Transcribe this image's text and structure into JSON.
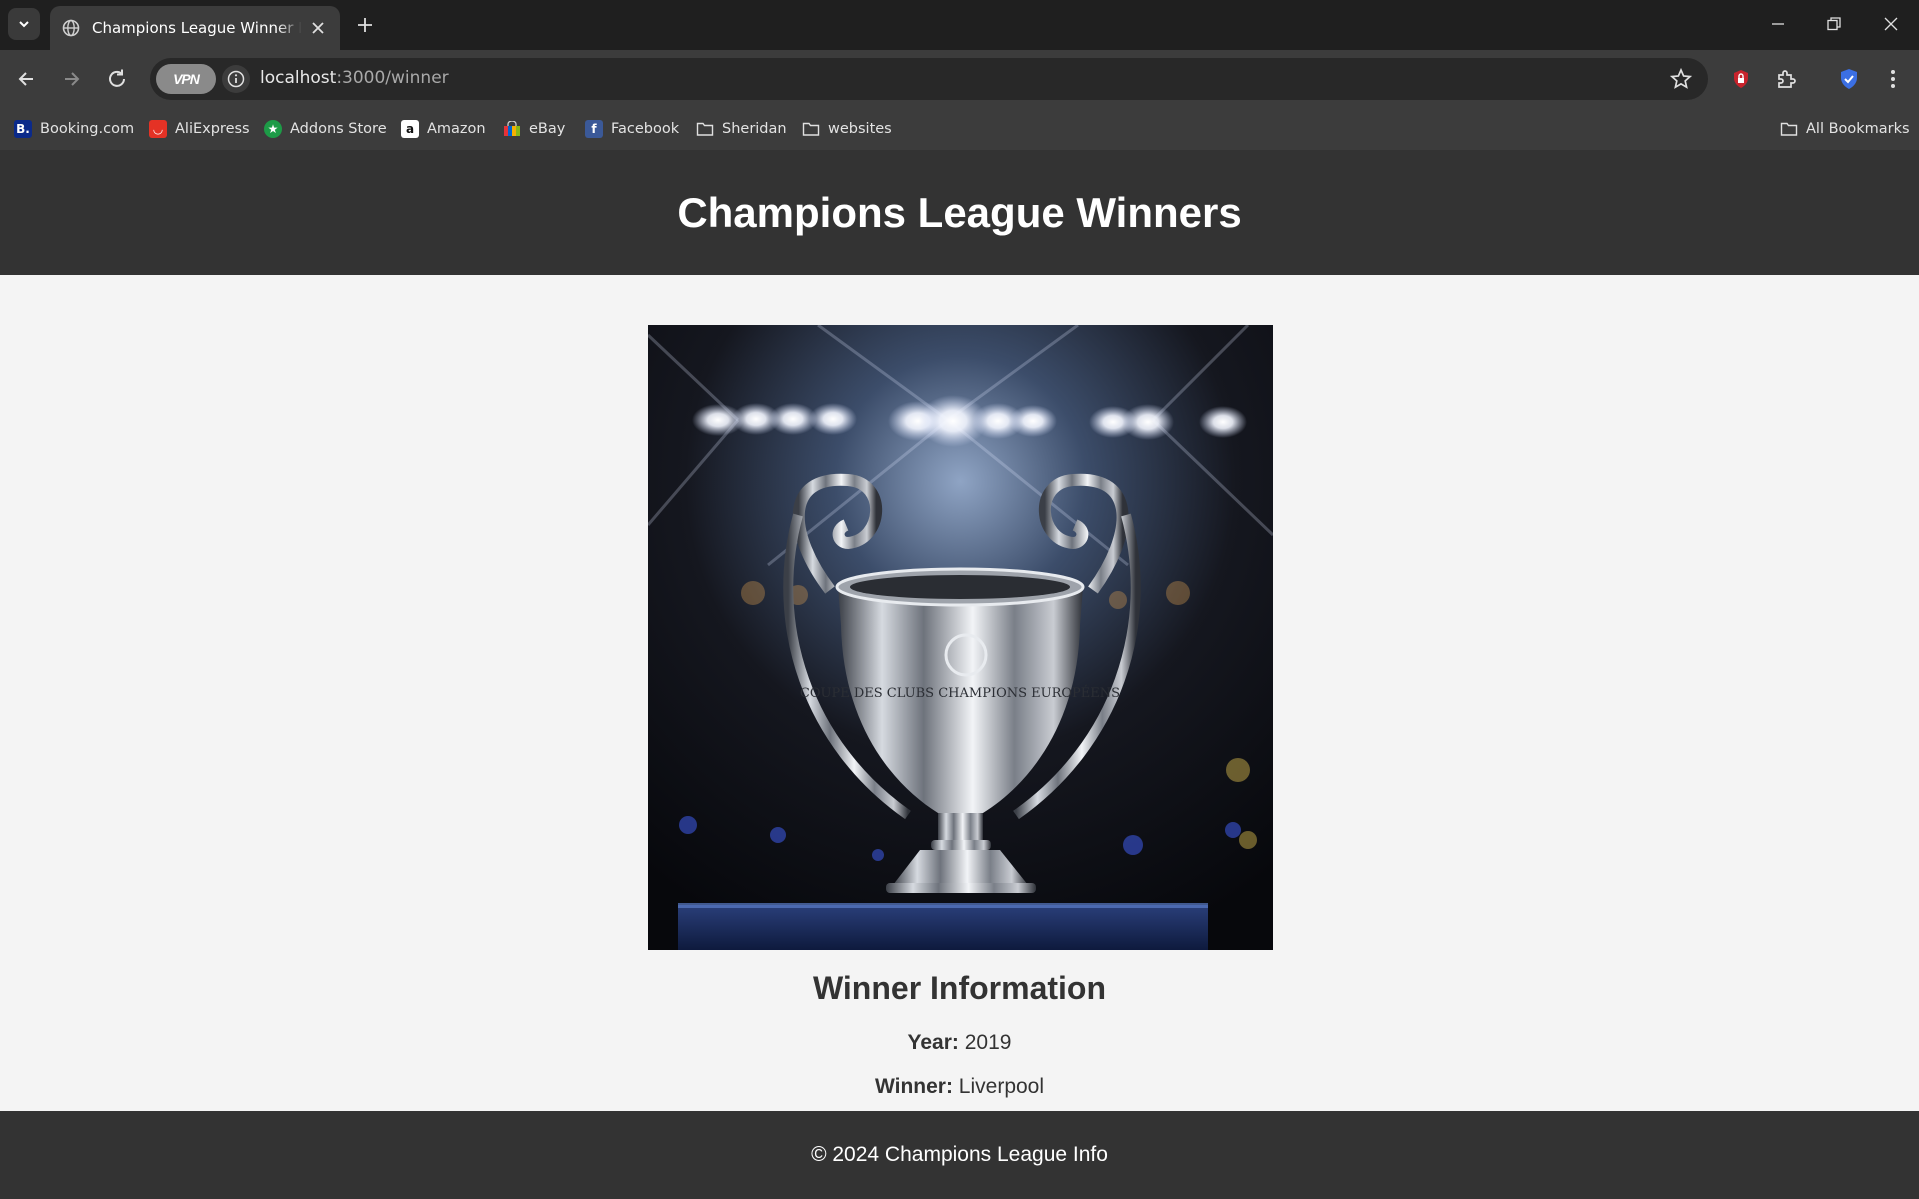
{
  "browser": {
    "tab_title": "Champions League Winner Info",
    "url_host": "localhost",
    "url_path": ":3000/winner",
    "vpn_label": "VPN",
    "bookmarks": [
      {
        "label": "Booking.com",
        "icon": "booking-icon",
        "color": "#0b2a8a"
      },
      {
        "label": "AliExpress",
        "icon": "aliexpress-icon",
        "color": "#e43225"
      },
      {
        "label": "Addons Store",
        "icon": "addons-store-icon",
        "color": "#1d9b47"
      },
      {
        "label": "Amazon",
        "icon": "amazon-icon",
        "color": "#ffffff"
      },
      {
        "label": "eBay",
        "icon": "ebay-icon",
        "color": "#e53238"
      },
      {
        "label": "Facebook",
        "icon": "facebook-icon",
        "color": "#3b5998"
      },
      {
        "label": "Sheridan",
        "icon": "folder-icon"
      },
      {
        "label": "websites",
        "icon": "folder-icon"
      }
    ],
    "all_bookmarks_label": "All Bookmarks"
  },
  "page": {
    "header_title": "Champions League Winners",
    "info_heading": "Winner Information",
    "year_label": "Year:",
    "year_value": "2019",
    "winner_label": "Winner:",
    "winner_value": "Liverpool",
    "trophy_engraving": "COUPE DES CLUBS CHAMPIONS EUROPÉENS",
    "footer_text": "© 2024 Champions League Info"
  },
  "colors": {
    "header_bg": "#333333",
    "page_bg": "#f4f4f4",
    "text": "#333333"
  }
}
